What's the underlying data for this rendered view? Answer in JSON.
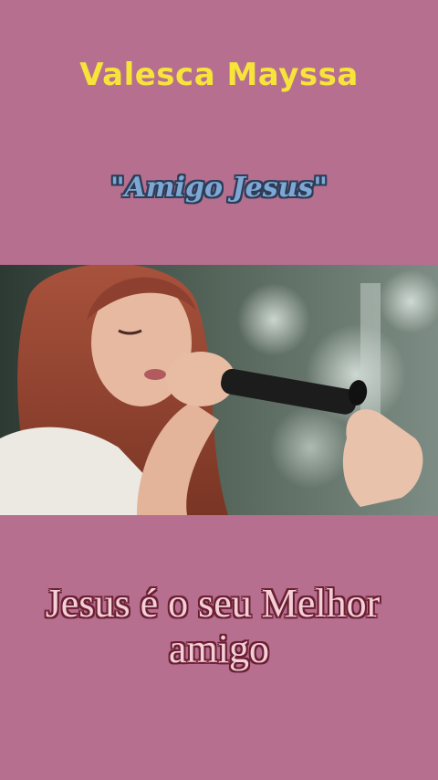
{
  "overlay": {
    "artist": "Valesca Mayssa",
    "song_title": "\"Amigo Jesus\"",
    "lyric_line_1": "Jesus é o seu Melhor",
    "lyric_line_2": "amigo"
  },
  "colors": {
    "background": "#b76f8f",
    "artist_text": "#f6e43a",
    "song_title_fill": "#7fa7d4",
    "song_title_outline": "#2b3d57",
    "lyric_fill": "#f3cfd8",
    "lyric_outline": "#6b1f33"
  },
  "video": {
    "subject": "singer-with-microphone"
  }
}
